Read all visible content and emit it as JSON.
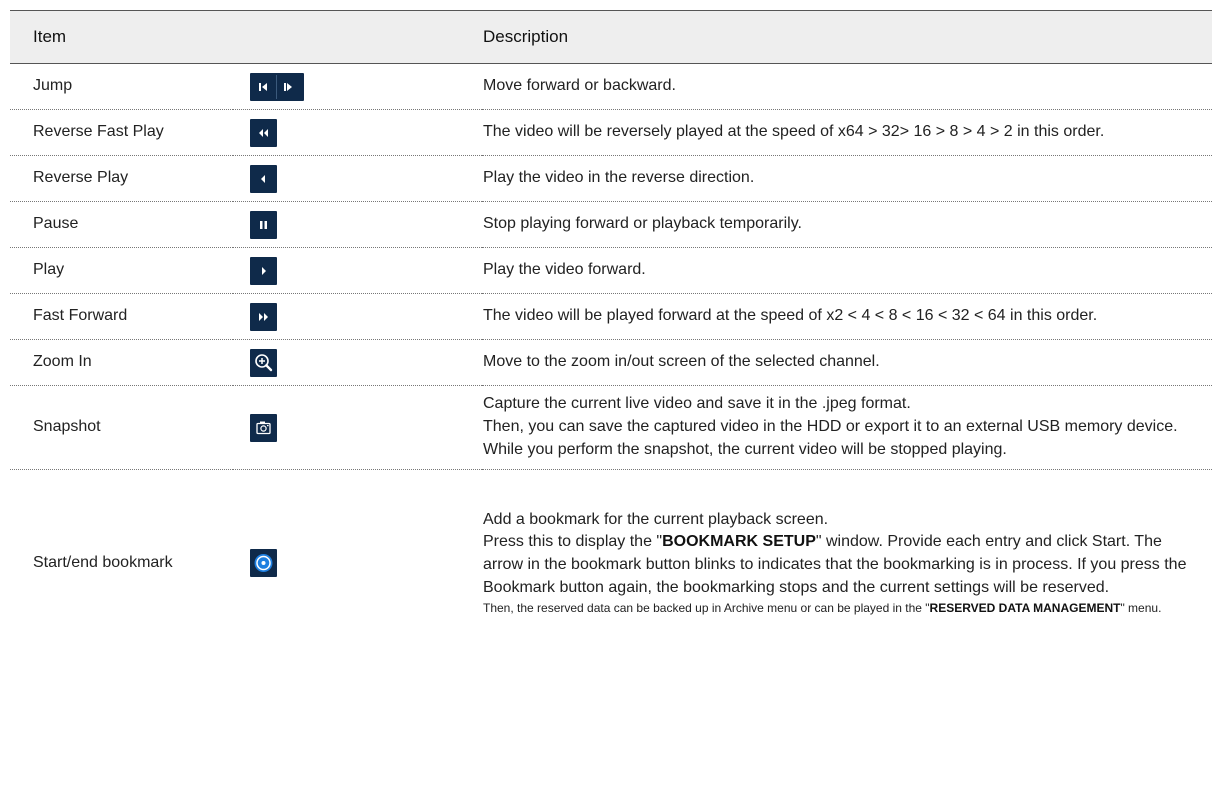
{
  "header": {
    "item": "Item",
    "description": "Description"
  },
  "rows": [
    {
      "item": "Jump",
      "icon": "jump-back-forward-icon",
      "desc": "Move forward or backward."
    },
    {
      "item": "Reverse Fast Play",
      "icon": "reverse-fast-play-icon",
      "desc": "The video will be reversely played at the speed of x64 > 32> 16 > 8 > 4 > 2 in this order."
    },
    {
      "item": "Reverse Play",
      "icon": "reverse-play-icon",
      "desc": "Play the video in the reverse direction."
    },
    {
      "item": "Pause",
      "icon": "pause-icon",
      "desc": "Stop playing forward or playback temporarily."
    },
    {
      "item": "Play",
      "icon": "play-icon",
      "desc": "Play the video forward."
    },
    {
      "item": "Fast Forward",
      "icon": "fast-forward-icon",
      "desc": "The video will be played forward at the speed of x2 < 4 < 8 < 16 < 32 < 64 in this order."
    },
    {
      "item": "Zoom In",
      "icon": "zoom-in-icon",
      "desc": "Move to the zoom in/out screen of the selected channel."
    },
    {
      "item": "Snapshot",
      "icon": "snapshot-camera-icon",
      "desc_lines": [
        "Capture the current live video and save it in the .jpeg format.",
        "Then, you can save the captured video in the HDD or export it to an external USB memory device.",
        "While you perform the snapshot, the current video will be stopped playing."
      ]
    },
    {
      "item": "Start/end bookmark",
      "icon": "bookmark-icon",
      "desc_p1": "Add a bookmark for the current playback screen.",
      "desc_p2_pre": "Press this to display the \"",
      "desc_p2_bold": "BOOKMARK SETUP",
      "desc_p2_post": "\" window. Provide each entry and click Start. The arrow in the bookmark button blinks to indicates that the bookmarking is in process. If you press the Bookmark button again, the bookmarking stops and the current settings will be reserved.",
      "desc_p3_pre": "Then, the reserved data can be backed up in Archive menu or can be played in the \"",
      "desc_p3_bold": "RESERVED DATA MANAGEMENT",
      "desc_p3_post": "\" menu."
    }
  ],
  "colors": {
    "button_bg": "#0f2a4a",
    "icon_fg": "#ffffff",
    "bookmark_blue": "#1e7fe0",
    "header_bg": "#eeeeee"
  }
}
